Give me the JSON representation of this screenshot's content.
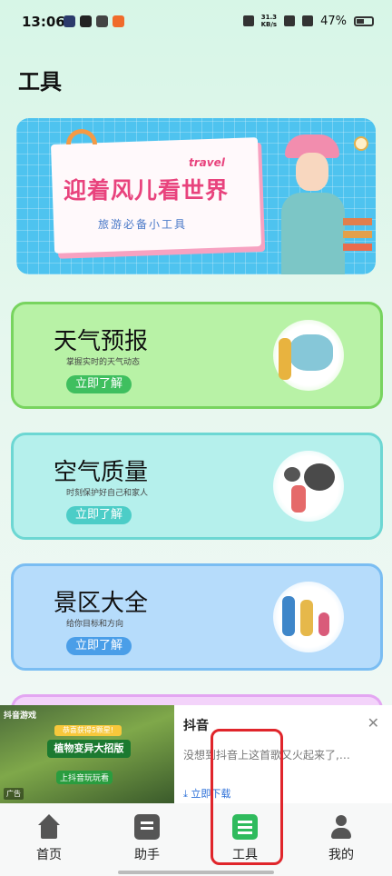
{
  "status_bar": {
    "time": "13:06",
    "network_speed_value": "31.3",
    "network_speed_unit": "KB/s",
    "battery": "47%"
  },
  "page": {
    "title": "工具"
  },
  "banner": {
    "title": "迎着风儿看世界",
    "subtitle": "旅游必备小工具",
    "tag": "travel"
  },
  "cards": [
    {
      "title": "天气预报",
      "desc": "掌握实时的天气动态",
      "button": "立即了解",
      "button_color": "#3fbf5f"
    },
    {
      "title": "空气质量",
      "desc": "时刻保护好自己和家人",
      "button": "立即了解",
      "button_color": "#4ccdc7"
    },
    {
      "title": "景区大全",
      "desc": "给你目标和方向",
      "button": "立即了解",
      "button_color": "#4a9ee8"
    }
  ],
  "ad": {
    "source_label": "抖音游戏",
    "stars_text": "恭喜获得5颗星!",
    "banner_title": "植物变异大招版",
    "banner_sub": "上抖音玩玩看",
    "badge": "广告",
    "brand": "抖音",
    "text": "没想到抖音上这首歌又火起来了,…",
    "download": "立即下载",
    "close_icon": "close-icon"
  },
  "tabbar": {
    "items": [
      {
        "label": "首页",
        "icon": "home-icon"
      },
      {
        "label": "助手",
        "icon": "assistant-icon"
      },
      {
        "label": "工具",
        "icon": "tools-icon",
        "active": true
      },
      {
        "label": "我的",
        "icon": "profile-icon"
      }
    ],
    "active_color": "#2fbb5d",
    "highlight_color": "#e0252b"
  }
}
